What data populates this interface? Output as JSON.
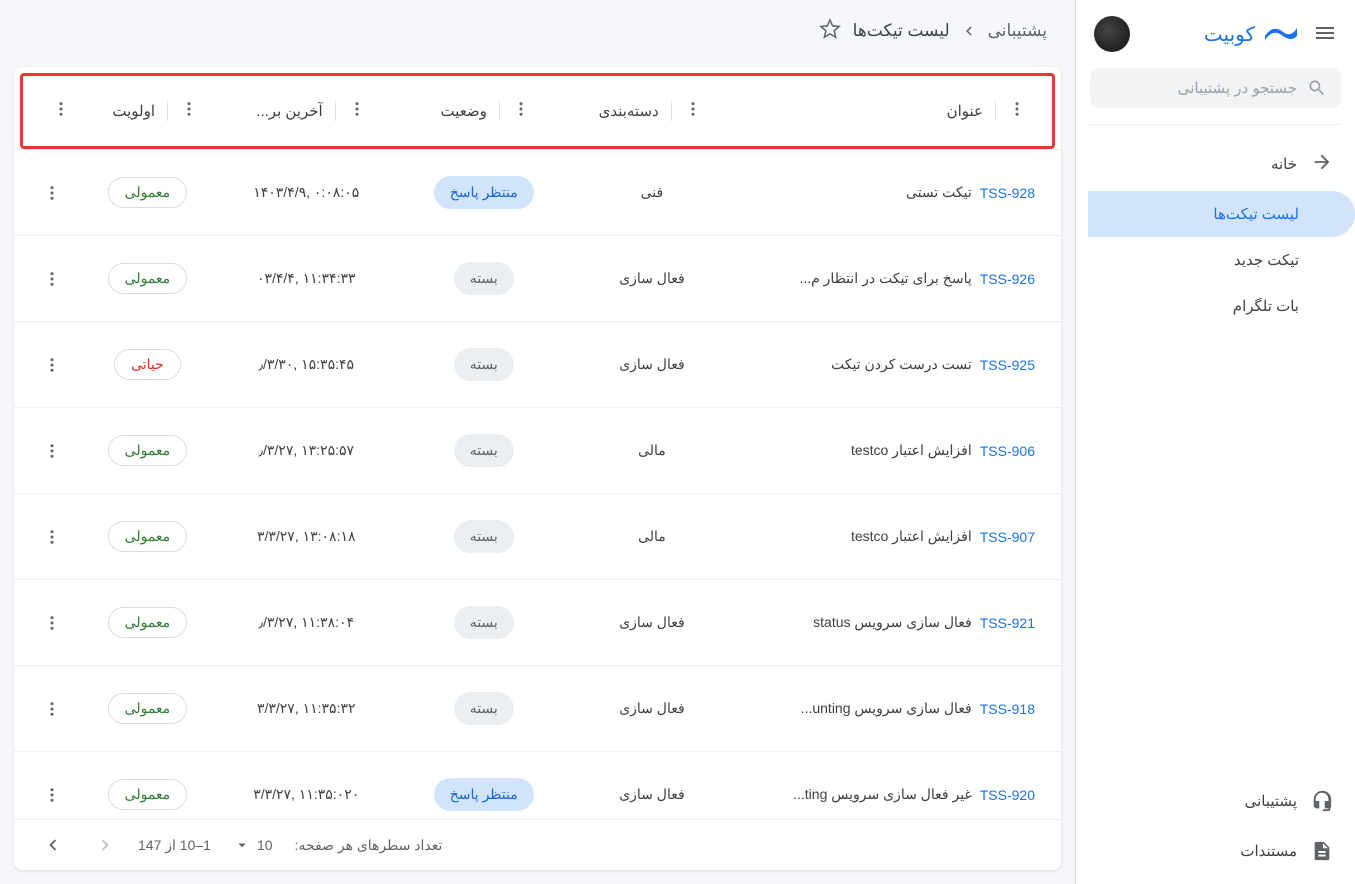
{
  "brand": "کوبیت",
  "search": {
    "placeholder": "جستجو در پشتیبانی"
  },
  "nav": {
    "home": "خانه",
    "tickets": "لیست تیکت‌ها",
    "new_ticket": "تیکت جدید",
    "telegram_bot": "بات تلگرام"
  },
  "bottom": {
    "support": "پشتیبانی",
    "docs": "مستندات"
  },
  "breadcrumb": {
    "root": "پشتیبانی",
    "current": "لیست تیکت‌ها"
  },
  "columns": {
    "title": "عنوان",
    "category": "دسته‌بندی",
    "status": "وضعیت",
    "updated": "آخرین بر...",
    "priority": "اولویت"
  },
  "status_labels": {
    "waiting": "منتظر پاسخ",
    "closed": "بسته"
  },
  "priority_labels": {
    "normal": "معمولی",
    "critical": "حیاتی"
  },
  "rows": [
    {
      "id": "TSS-928",
      "subject": "تیکت تستی",
      "category": "فنی",
      "status": "waiting",
      "updated": "۱۴۰۳/۴/۹, ۰:۰۸:۰۵",
      "priority": "normal"
    },
    {
      "id": "TSS-926",
      "subject": "پاسخ برای تیکت در انتظار م...",
      "category": "فعال سازی",
      "status": "closed",
      "updated": "۰۳/۴/۴, ۱۱:۳۴:۳۳",
      "priority": "normal"
    },
    {
      "id": "TSS-925",
      "subject": "تست درست کردن تیکت",
      "category": "فعال سازی",
      "status": "closed",
      "updated": "٫/۳/۳۰, ۱۵:۳۵:۴۵",
      "priority": "critical"
    },
    {
      "id": "TSS-906",
      "subject": "افزایش اعتبار testco",
      "category": "مالی",
      "status": "closed",
      "updated": "٫/۳/۲۷, ۱۳:۲۵:۵۷",
      "priority": "normal"
    },
    {
      "id": "TSS-907",
      "subject": "افزایش اعتبار testco",
      "category": "مالی",
      "status": "closed",
      "updated": "۳/۳/۲۷, ۱۳:۰۸:۱۸",
      "priority": "normal"
    },
    {
      "id": "TSS-921",
      "subject": "فعال سازی سرویس status",
      "category": "فعال سازی",
      "status": "closed",
      "updated": "٫/۳/۲۷, ۱۱:۳۸:۰۴",
      "priority": "normal"
    },
    {
      "id": "TSS-918",
      "subject": "فعال سازی سرویس unting...",
      "category": "فعال سازی",
      "status": "closed",
      "updated": "۳/۳/۲۷, ۱۱:۳۵:۳۲",
      "priority": "normal"
    },
    {
      "id": "TSS-920",
      "subject": "غیر فعال سازی سرویس ting...",
      "category": "فعال سازی",
      "status": "waiting",
      "updated": "۳/۳/۲۷, ۱۱:۳۵:۰۲۰",
      "priority": "normal"
    }
  ],
  "pagination": {
    "rows_per_page_label": "تعداد سطرهای هر صفحه:",
    "rows_per_page_value": "10",
    "range": "1–10 از 147"
  }
}
